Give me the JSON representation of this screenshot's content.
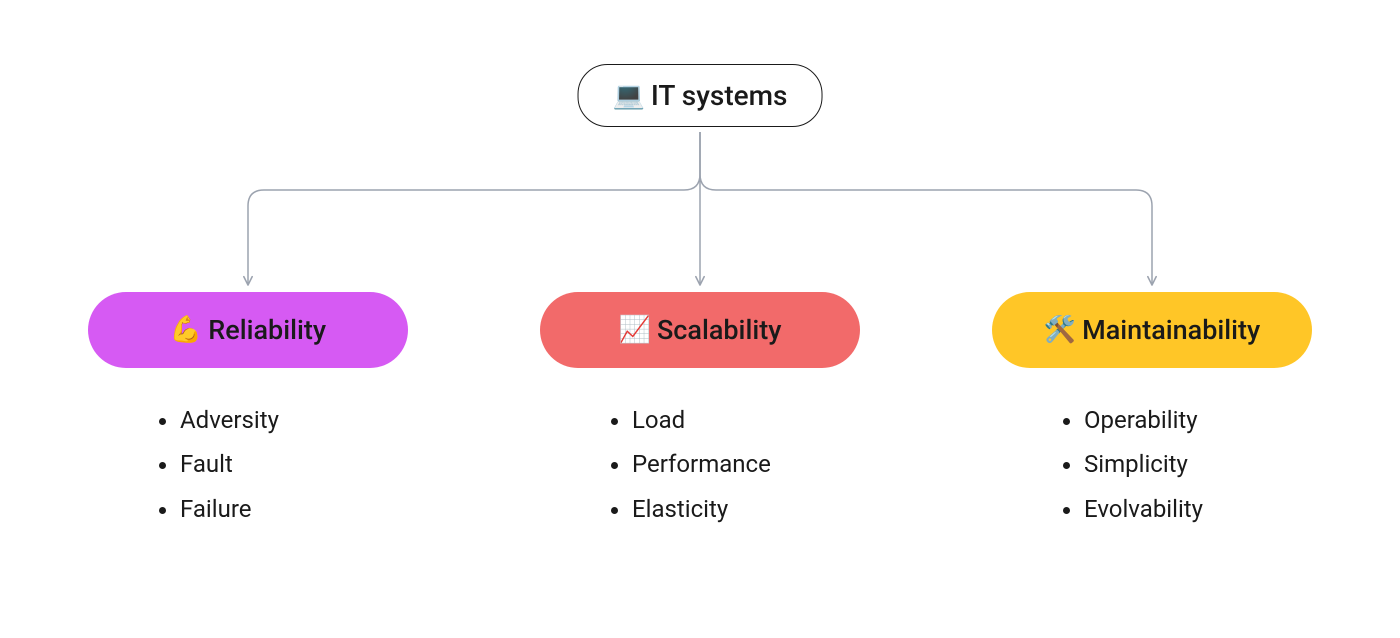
{
  "root": {
    "emoji": "💻",
    "label": "IT systems"
  },
  "children": [
    {
      "emoji": "💪",
      "label": "Reliability",
      "color": "#D65AF3",
      "bullets": [
        "Adversity",
        "Fault",
        "Failure"
      ]
    },
    {
      "emoji": "📈",
      "label": "Scalability",
      "color": "#F26A6A",
      "bullets": [
        "Load",
        "Performance",
        "Elasticity"
      ]
    },
    {
      "emoji": "🛠️",
      "label": "Maintainability",
      "color": "#FFC627",
      "bullets": [
        "Operability",
        "Simplicity",
        "Evolvability"
      ]
    }
  ],
  "connector": {
    "stroke": "#9ca3af",
    "strokeWidth": "1.5"
  }
}
